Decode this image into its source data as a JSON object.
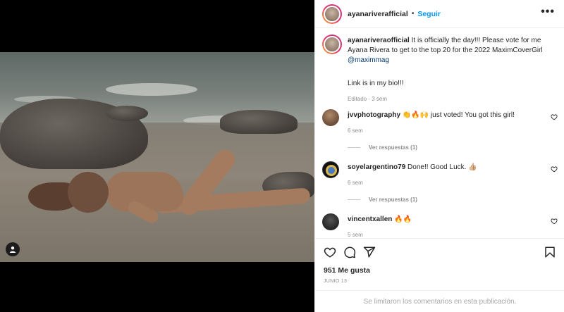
{
  "post": {
    "username": "ayanariverafficial",
    "follow_label": "Seguir",
    "separator": "•",
    "more_label": "•••"
  },
  "caption": {
    "username": "ayanariveraofficial",
    "text": " It is officially the day!!! Please vote for me Ayana Rivera to get to the top 20 for the 2022 MaximCoverGirl ",
    "mention": "@maximmag",
    "link_text": "Link is in my bio!!!",
    "meta": "Editado · 3 sem"
  },
  "comments": [
    {
      "username": "jvvphotography",
      "text": " 👏🔥🙌 just voted! You got this girl!",
      "time": "6 sem",
      "replies": "Ver respuestas (1)"
    },
    {
      "username": "soyelargentino79",
      "text": " Done!! Good Luck. 👍🏼",
      "time": "6 sem",
      "replies": "Ver respuestas (1)"
    },
    {
      "username": "vincentxallen",
      "text": " 🔥🔥",
      "time": "5 sem"
    }
  ],
  "stats": {
    "likes": "951 Me gusta",
    "date": "JUNIO 13"
  },
  "footer": {
    "text": "Se limitaron los comentarios en esta publicación."
  },
  "icons": {
    "like": "heart-icon",
    "comment": "comment-icon",
    "share": "send-icon",
    "save": "bookmark-icon",
    "tag": "user-tag-icon"
  },
  "colors": {
    "accent": "#0095f6",
    "text": "#262626",
    "muted": "#8e8e8e",
    "mention": "#00376b"
  }
}
